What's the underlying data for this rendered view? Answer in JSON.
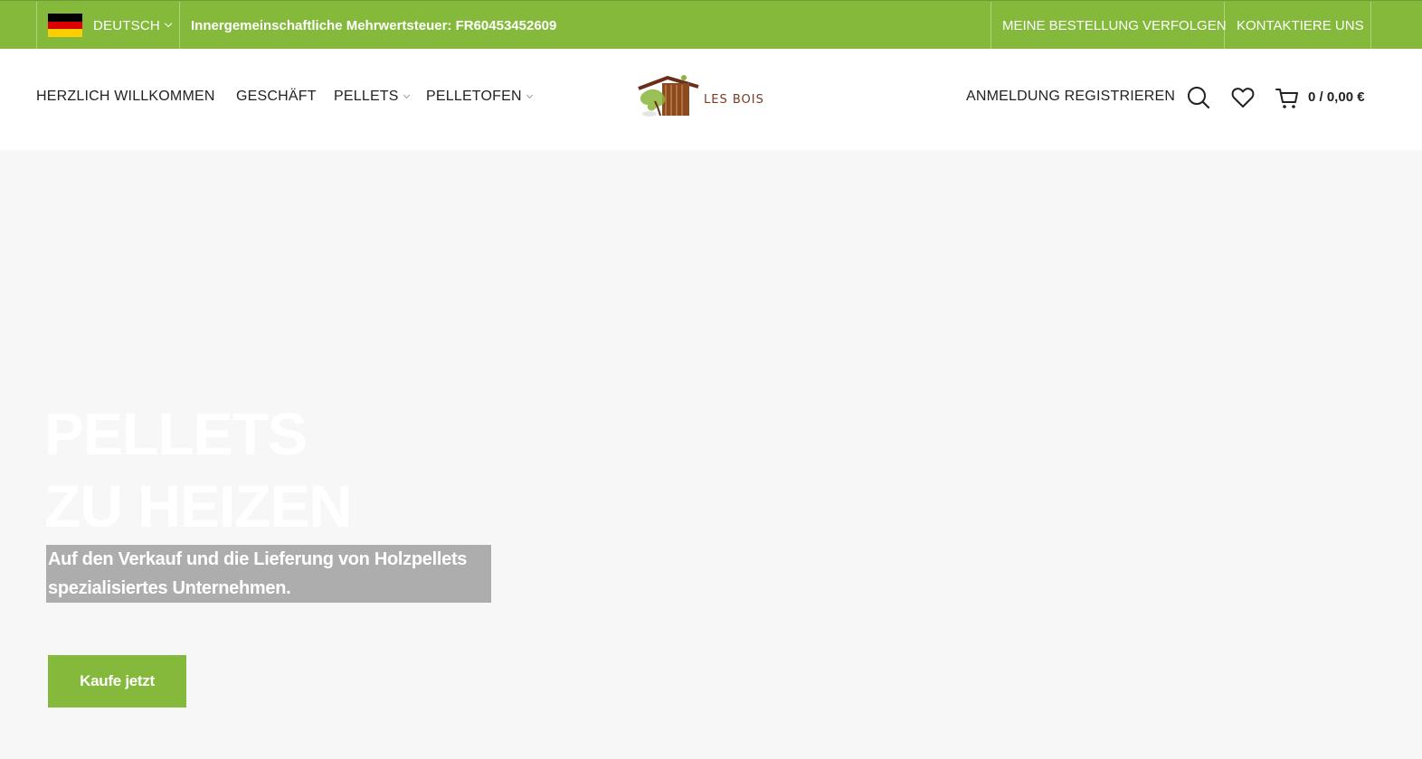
{
  "topbar": {
    "language": "DEUTSCH",
    "vat_text": "Innergemeinschaftliche Mehrwertsteuer: FR60453452609",
    "track_order": "MEINE BESTELLUNG VERFOLGEN",
    "contact": "KONTAKTIERE UNS",
    "flag_colors": [
      "#000000",
      "#dd0000",
      "#ffce00"
    ],
    "bg_color": "#84b93c"
  },
  "nav": {
    "items": [
      {
        "label": "HERZLICH WILLKOMMEN"
      },
      {
        "label": "GESCHÄFT"
      },
      {
        "label": "PELLETS"
      },
      {
        "label": "PELLETOFEN"
      }
    ]
  },
  "logo": {
    "text": "LES BOIS"
  },
  "header": {
    "account": "ANMELDUNG REGISTRIEREN",
    "cart_total": "0 / 0,00 €",
    "icons": [
      "search-icon",
      "heart-icon",
      "cart-icon"
    ]
  },
  "hero": {
    "title_line1": "PELLETS",
    "title_line2": "ZU HEIZEN",
    "subtitle_line1": "Auf den Verkauf und die Lieferung von Holzpellets",
    "subtitle_line2": "spezialisiertes Unternehmen.",
    "cta": "Kaufe jetzt",
    "accent": "#84b93c"
  }
}
